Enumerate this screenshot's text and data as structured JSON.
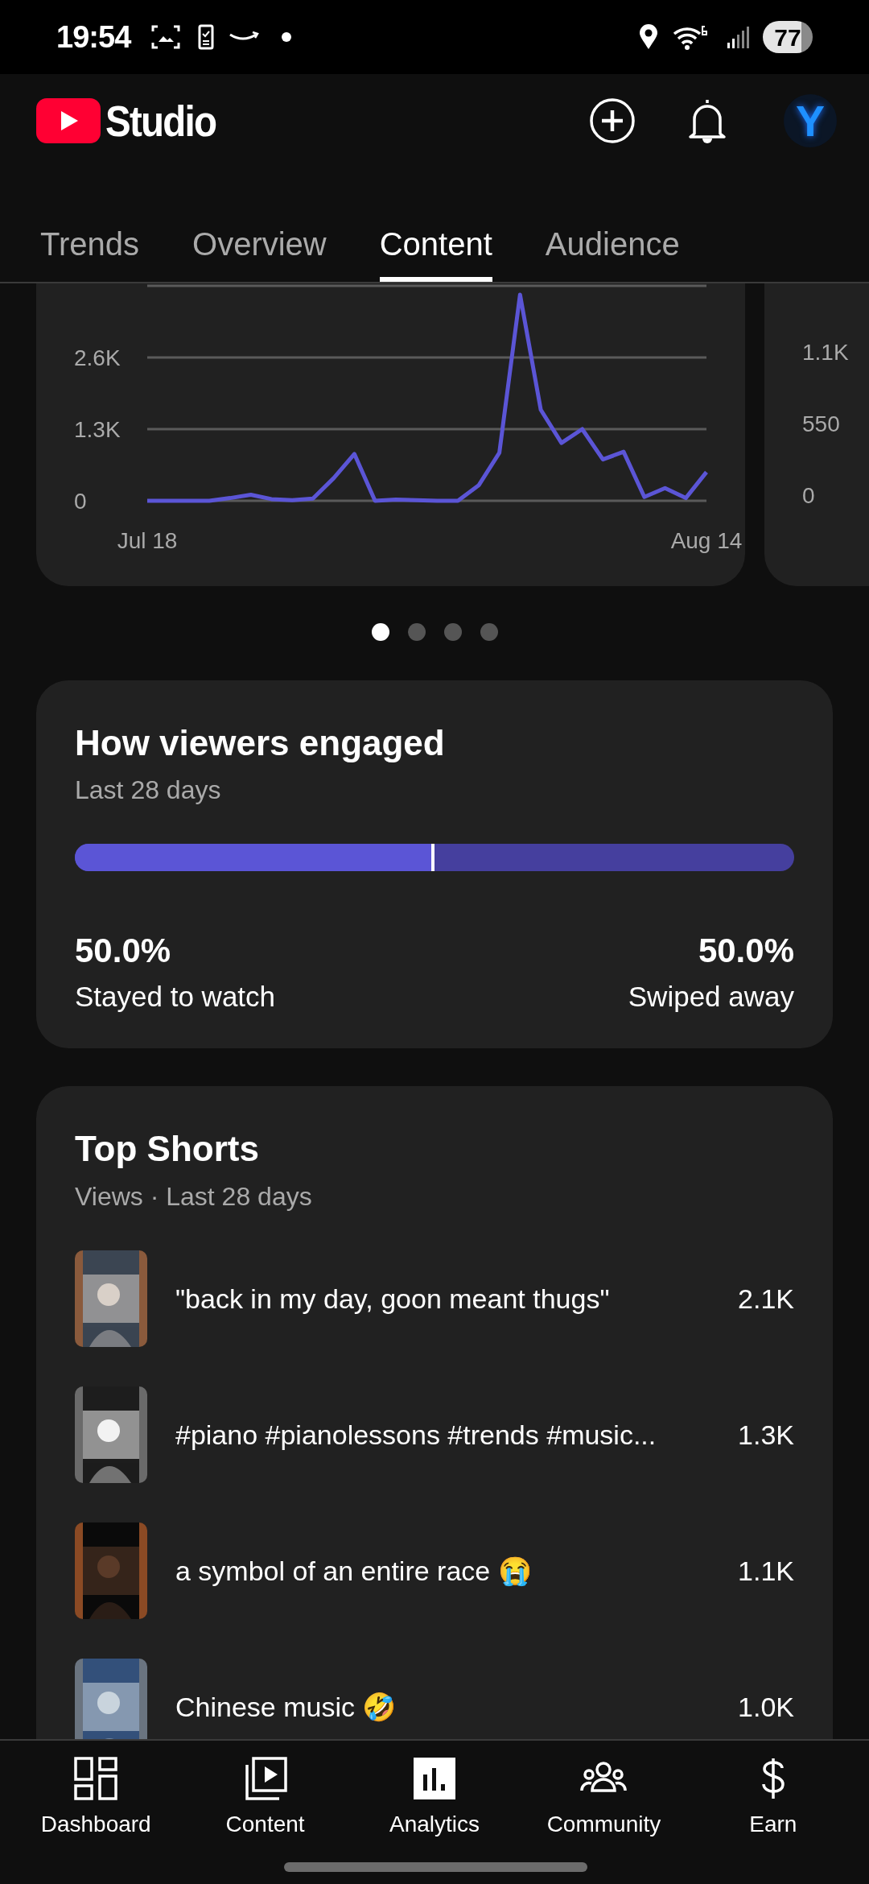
{
  "status_bar": {
    "time": "19:54",
    "battery": "77"
  },
  "header": {
    "logo": "Studio",
    "avatar_initial": "Y"
  },
  "tabs": [
    {
      "label": "Trends",
      "selected": false
    },
    {
      "label": "Overview",
      "selected": false
    },
    {
      "label": "Content",
      "selected": true
    },
    {
      "label": "Audience",
      "selected": false
    }
  ],
  "views_chart": {
    "chart_data": {
      "type": "line",
      "categories": [
        "Jul 18",
        null,
        null,
        null,
        null,
        null,
        null,
        null,
        null,
        null,
        null,
        null,
        null,
        null,
        null,
        null,
        null,
        null,
        null,
        null,
        null,
        null,
        null,
        null,
        null,
        null,
        null,
        "Aug 14"
      ],
      "ylim": [
        0,
        3900
      ],
      "series": [
        {
          "color": "#5b55d6",
          "values": [
            0,
            0,
            0,
            0,
            50,
            110,
            30,
            10,
            40,
            410,
            850,
            0,
            20,
            10,
            0,
            0,
            280,
            870,
            3740,
            1650,
            1050,
            1300,
            750,
            890,
            70,
            230,
            50,
            520
          ]
        }
      ],
      "yticks": [
        {
          "value": 0,
          "label": "0"
        },
        {
          "value": 1300,
          "label": "1.3K"
        },
        {
          "value": 2600,
          "label": "2.6K"
        }
      ]
    }
  },
  "next_chart": {
    "y_labels": [
      "1.1K",
      "550",
      "0"
    ]
  },
  "page_dots": [
    {
      "selected": true
    },
    {
      "selected": false
    },
    {
      "selected": false
    },
    {
      "selected": false
    }
  ],
  "engagement": {
    "title": "How viewers engaged",
    "subtitle": "Last 28 days",
    "level": 0.5,
    "left_value": "50.0%",
    "left_label": "Stayed to watch",
    "right_value": "50.0%",
    "right_label": "Swiped away"
  },
  "top_shorts": {
    "title": "Top Shorts",
    "subtitle": "Views · Last 28 days",
    "items": [
      {
        "title": "\"back in my day, goon meant thugs\"",
        "views": "2.1K"
      },
      {
        "title": "#piano #pianolessons #trends #music...",
        "views": "1.3K"
      },
      {
        "title": "a symbol of an entire race 😭",
        "views": "1.1K"
      },
      {
        "title": "Chinese music 🤣",
        "views": "1.0K"
      }
    ]
  },
  "bottom_nav": [
    {
      "label": "Dashboard",
      "kind": "dashboard",
      "selected": false
    },
    {
      "label": "Content",
      "kind": "content",
      "selected": false
    },
    {
      "label": "Analytics",
      "kind": "analytics",
      "selected": true
    },
    {
      "label": "Community",
      "kind": "community",
      "selected": false
    },
    {
      "label": "Earn",
      "kind": "earn",
      "selected": false
    }
  ]
}
